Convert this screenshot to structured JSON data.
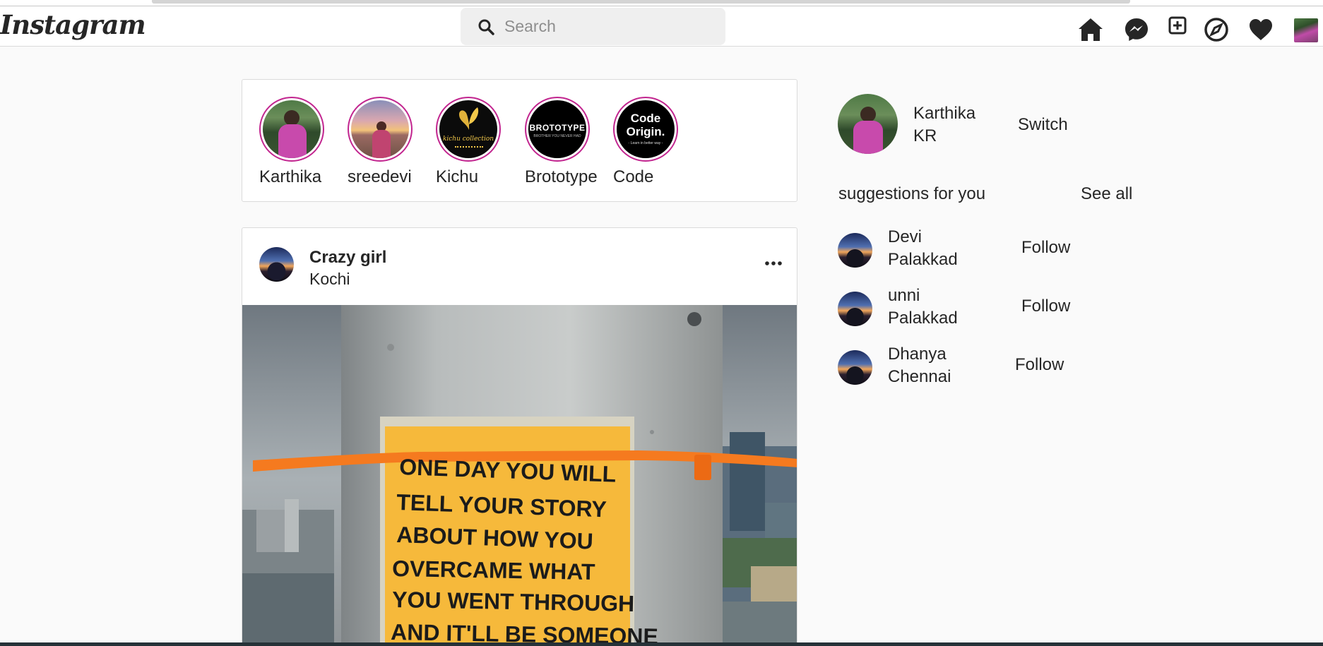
{
  "app": {
    "logo_text": "Instagram"
  },
  "search": {
    "placeholder": "Search",
    "value": ""
  },
  "nav": {
    "icons": [
      "home-icon",
      "messenger-icon",
      "new-post-icon",
      "explore-icon",
      "activity-heart-icon",
      "profile-avatar"
    ]
  },
  "stories": [
    {
      "label": "Karthika"
    },
    {
      "label": "sreedevi"
    },
    {
      "label": "Kichu",
      "logo_text": "kichu collection"
    },
    {
      "label": "Brototype",
      "logo_text": "BROTOTYPE",
      "logo_subtext": "BROTHER YOU NEVER HAD"
    },
    {
      "label": "Code",
      "logo_text_1": "Code",
      "logo_text_2": "Origin.",
      "logo_subtext": "- Learn in better way -"
    }
  ],
  "post": {
    "username": "Crazy girl",
    "location": "Kochi",
    "note_lines": [
      "ONE DAY YOU WILL",
      "TELL YOUR STORY",
      "ABOUT HOW YOU",
      "OVERCAME WHAT",
      "YOU WENT THROUGH",
      "AND IT'LL BE SOMEONE"
    ]
  },
  "sidebar": {
    "me": {
      "name": "Karthika KR",
      "action": "Switch"
    },
    "suggestions_title": "suggestions for you",
    "see_all": "See all",
    "suggestions": [
      {
        "name": "Devi Palakkad",
        "action": "Follow"
      },
      {
        "name": "unni Palakkad",
        "action": "Follow"
      },
      {
        "name": "Dhanya Chennai",
        "action": "Follow"
      }
    ]
  },
  "colors": {
    "story_ring": "#c2258f",
    "background": "#fafafa",
    "card_border": "#dbdbdb",
    "note_yellow": "#f6b93b",
    "zip_tie": "#f57a1f"
  }
}
